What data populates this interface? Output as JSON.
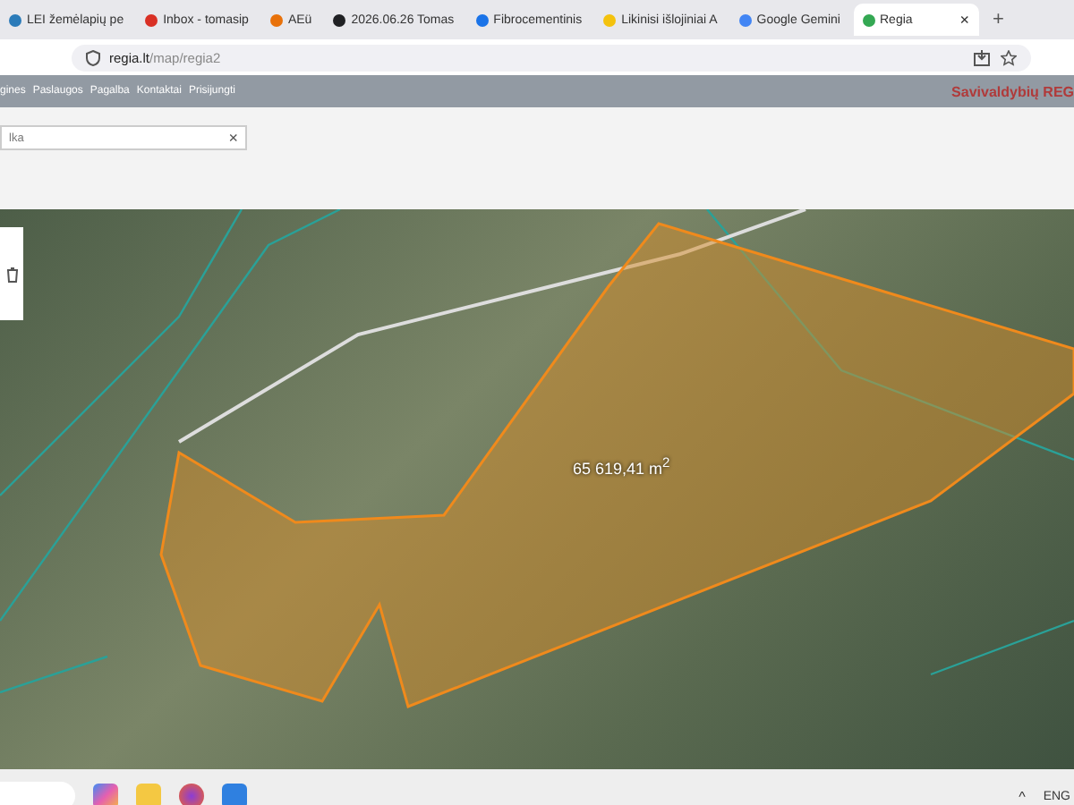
{
  "browser": {
    "tabs": [
      {
        "title": "LEI žemėlapių pe",
        "selected": false,
        "color": "#2b7bb9"
      },
      {
        "title": "Inbox - tomasip",
        "selected": false,
        "color": "#d93025"
      },
      {
        "title": "AEü",
        "selected": false,
        "color": "#e8710a"
      },
      {
        "title": "2026.06.26 Tomas",
        "selected": false,
        "color": "#202124"
      },
      {
        "title": "Fibrocementinis",
        "selected": false,
        "color": "#1a73e8"
      },
      {
        "title": "Likinisi išlojiniai A",
        "selected": false,
        "color": "#f4c20d"
      },
      {
        "title": "Google Gemini",
        "selected": false,
        "color": "#4285f4"
      },
      {
        "title": "Regia",
        "selected": true,
        "color": "#34a853"
      }
    ],
    "close_glyph": "×",
    "new_tab_glyph": "+",
    "url_host": "regia.lt",
    "url_path": "/map/regia2"
  },
  "nav": {
    "items": [
      "gines",
      "Paslaugos",
      "Pagalba",
      "Kontaktai",
      "Prisijungti"
    ],
    "brand": "Savivaldybių REG"
  },
  "search": {
    "value": "lka",
    "clear_glyph": "×"
  },
  "map": {
    "area_label": "65 619,41 m$^{2}$"
  },
  "taskbar": {
    "caret": "^",
    "language": "ENG"
  }
}
